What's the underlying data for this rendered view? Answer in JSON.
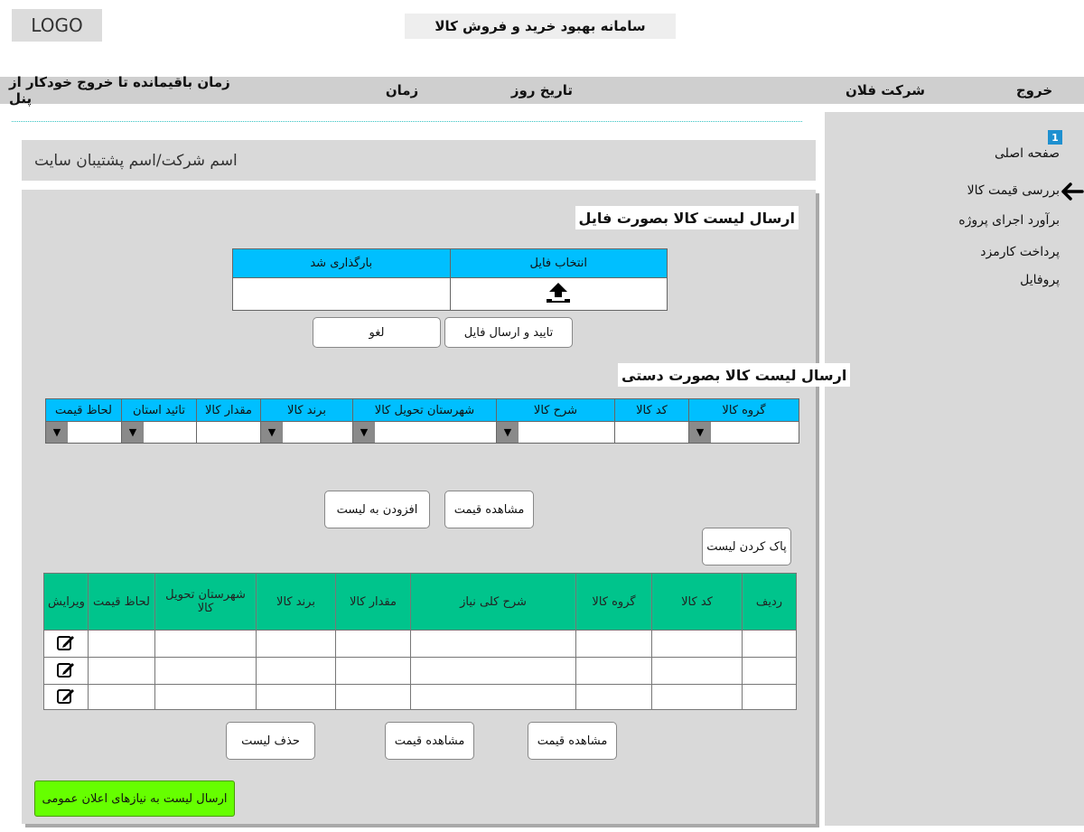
{
  "header": {
    "logo": "LOGO",
    "site_title": "سامانه بهبود خرید و فروش کالا"
  },
  "topbar": {
    "exit": "خروج",
    "company": "شرکت فلان",
    "date": "تاریخ روز",
    "time": "زمان",
    "remaining": "زمان باقیمانده تا خروج خودکار از پنل"
  },
  "sidebar": {
    "badge": "1",
    "items": [
      {
        "label": "صفحه اصلی"
      },
      {
        "label": "بررسی قیمت کالا"
      },
      {
        "label": "برآورد اجرای پروژه"
      },
      {
        "label": "پرداخت کارمزد"
      },
      {
        "label": "پروفایل"
      }
    ],
    "active_icon": "arrow-left-icon"
  },
  "company_box": "اسم شرکت/اسم پشتیبان سایت",
  "file_section": {
    "title": "ارسال لیست کالا بصورت فایل",
    "col_select": "انتخاب فایل",
    "col_uploaded": "بارگذاری شد",
    "upload_icon": "upload-icon",
    "confirm_button": "تایید و ارسال فایل",
    "cancel_button": "لغو"
  },
  "manual_section": {
    "title": "ارسال لیست کالا بصورت دستی",
    "columns": [
      "گروه کالا",
      "کد کالا",
      "شرح کالا",
      "شهرستان تحویل کالا",
      "برند کالا",
      "مقدار کالا",
      "تائید استان",
      "لحاظ قیمت"
    ],
    "view_price_button": "مشاهده قیمت",
    "add_button": "افزودن به لیست",
    "clear_button": "پاک کردن لیست"
  },
  "list_table": {
    "columns": [
      "ردیف",
      "کد کالا",
      "گروه کالا",
      "شرح کلی نیاز",
      "مقدار کالا",
      "برند کالا",
      "شهرستان تحویل کالا",
      "لحاظ قیمت",
      "ویرایش"
    ],
    "rows": 3,
    "edit_icon": "edit-icon"
  },
  "bottom_buttons": {
    "view_price_1": "مشاهده قیمت",
    "view_price_2": "مشاهده قیمت",
    "delete_list": "حذف لیست"
  },
  "send_button": "ارسال لیست به نیازهای اعلان عمومی",
  "colors": {
    "header_blue": "#00bfff",
    "table_green": "#00c48c",
    "send_green": "#66ff00",
    "panel_gray": "#d9d9d9"
  }
}
